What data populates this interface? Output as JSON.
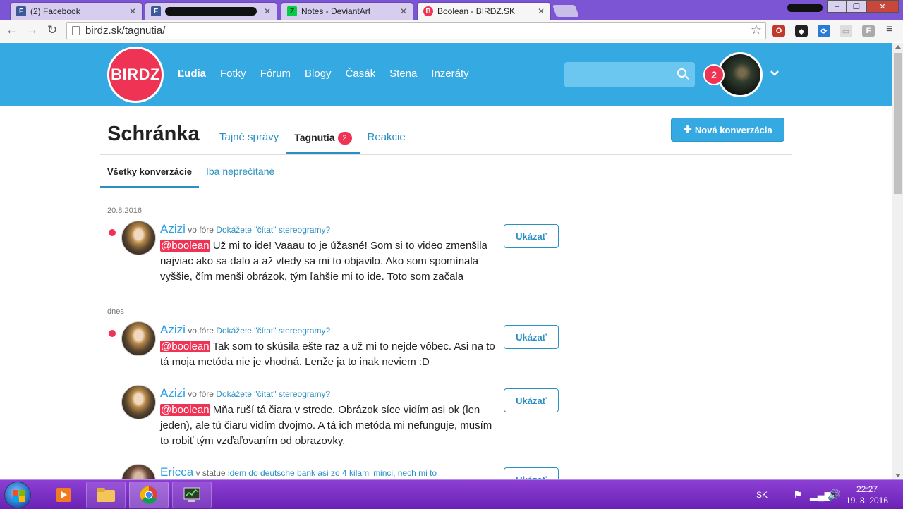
{
  "browser": {
    "tabs": [
      {
        "title": "(2) Facebook",
        "icon": "F"
      },
      {
        "title": "",
        "icon": "F"
      },
      {
        "title": "Notes - DeviantArt",
        "icon": "Z"
      },
      {
        "title": "Boolean - BIRDZ.SK",
        "icon": "B"
      }
    ],
    "address": "birdz.sk/tagnutia/",
    "colors": {
      "tabbar": "#7b55d3",
      "accent": "#35a9e1",
      "pink": "#ee3355"
    }
  },
  "site": {
    "logo": "BIRDZ",
    "nav": [
      "Ľudia",
      "Fotky",
      "Fórum",
      "Blogy",
      "Časák",
      "Stena",
      "Inzeráty"
    ],
    "notifications": "2"
  },
  "inbox": {
    "title": "Schránka",
    "tabs": [
      {
        "label": "Tajné správy"
      },
      {
        "label": "Tagnutia",
        "count": "2"
      },
      {
        "label": "Reakcie"
      }
    ],
    "new_button": "Nová konverzácia",
    "subtabs": [
      "Všetky konverzácie",
      "Iba neprečítané"
    ],
    "groups": [
      {
        "date": "20.8.2016"
      },
      {
        "date": "dnes"
      }
    ],
    "items": [
      {
        "user": "Azizi",
        "context": "vo fóre",
        "topic": "Dokážete \"čítat\" stereogramy?",
        "mention": "@boolean",
        "text": "Už mi to ide! Vaaau to je úžasné! Som si to video zmenšila najviac ako sa dalo a až vtedy sa mi to objavilo. Ako som spomínala vyššie, čím menši obrázok, tým ľahšie mi to ide. Toto som začala",
        "action": "Ukázať"
      },
      {
        "user": "Azizi",
        "context": "vo fóre",
        "topic": "Dokážete \"čítat\" stereogramy?",
        "mention": "@boolean",
        "text": "Tak som to skúsila ešte raz a už mi to nejde vôbec. Asi na to tá moja metóda nie je vhodná. Lenže ja to inak neviem :D",
        "action": "Ukázať"
      },
      {
        "user": "Azizi",
        "context": "vo fóre",
        "topic": "Dokážete \"čítat\" stereogramy?",
        "mention": "@boolean",
        "text": "Mňa ruší tá čiara v strede. Obrázok síce vidím asi ok (len jeden), ale tú čiaru vidím dvojmo. A tá ich metóda mi nefunguje, musím to robiť tým vzďaľovaním od obrazovky.",
        "action": "Ukázať"
      },
      {
        "user": "Ericca",
        "context": "v statue",
        "topic": "idem do deutsche bank asi zo 4 kilami minci, nech mi to",
        "action": "Ukázať"
      }
    ]
  },
  "taskbar": {
    "lang": "SK",
    "time": "22:27",
    "date": "19. 8. 2016"
  }
}
